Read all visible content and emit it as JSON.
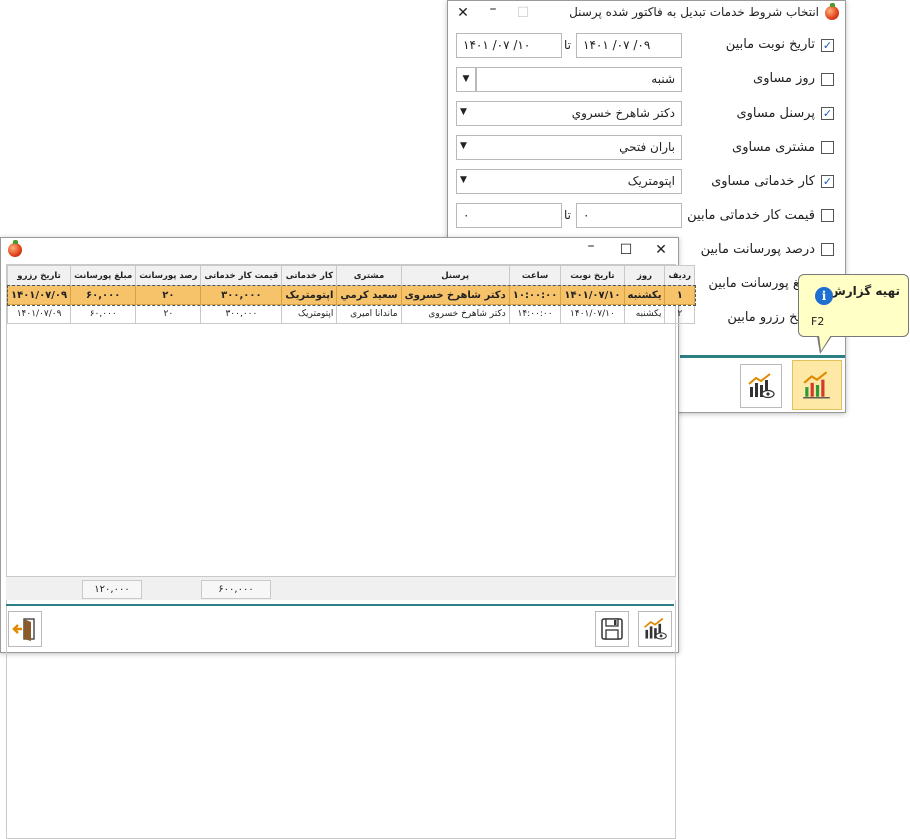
{
  "dialog": {
    "title": "انتخاب شروط خدمات تبدیل به فاکتور شده پرسنل",
    "rows": [
      {
        "label": "تاریخ نوبت مابین",
        "checked": true
      },
      {
        "label": "روز مساوی",
        "checked": false
      },
      {
        "label": "پرسنل مساوی",
        "checked": true
      },
      {
        "label": "مشتری مساوی",
        "checked": false
      },
      {
        "label": "کار خدماتی مساوی",
        "checked": true
      },
      {
        "label": "قیمت کار خدماتی مابین",
        "checked": false
      },
      {
        "label": "درصد پورسانت مابین",
        "checked": false
      },
      {
        "label": "مبلغ پورسانت مابین",
        "checked": false
      },
      {
        "label": "تاریخ رزرو مابین",
        "checked": false
      }
    ],
    "date_from": "۱۴۰۱ /۰۷ /۰۹",
    "date_to": "۱۴۰۱ /۰۷ /۱۰",
    "range_sep": "تا",
    "day_value": "شنبه",
    "personnel_value": "دکتر شاهرخ خسروي",
    "customer_value": "باران فتحي",
    "service_value": "اپتومتريک",
    "price_from": "۰",
    "price_to": "۰",
    "checkmark": "✓"
  },
  "tooltip": {
    "title": "تهیه گزارش",
    "shortcut": "F2",
    "info": "i"
  },
  "report": {
    "columns": [
      "رديف",
      "روز",
      "تاريخ نوبت",
      "ساعت",
      "پرسنل",
      "مشتری",
      "کار خدماتی",
      "قيمت کار خدماتی",
      "رصد پورسانت",
      "مبلغ پورسانت",
      "تاريخ رزرو"
    ],
    "rows": [
      [
        "۱",
        "يکشنبه",
        "۱۴۰۱/۰۷/۱۰",
        "۱۰:۰۰:۰۰",
        "دکتر شاهرخ خسروی",
        "سعيد کرمي",
        "اپتومتريک",
        "۳۰۰,۰۰۰",
        "۲۰",
        "۶۰,۰۰۰",
        "۱۴۰۱/۰۷/۰۹"
      ],
      [
        "۲",
        "يکشنبه",
        "۱۴۰۱/۰۷/۱۰",
        "۱۴:۰۰:۰۰",
        "دکتر شاهرخ خسروی",
        "ماندانا اميری",
        "اپتومتريک",
        "۳۰۰,۰۰۰",
        "۲۰",
        "۶۰,۰۰۰",
        "۱۴۰۱/۰۷/۰۹"
      ]
    ],
    "sum_price": "۶۰۰,۰۰۰",
    "sum_commission": "۱۲۰,۰۰۰"
  },
  "colors": {
    "accent": "#2d7f86",
    "selected_row": "#f6c26a",
    "tooltip_bg": "#ffffc6"
  }
}
